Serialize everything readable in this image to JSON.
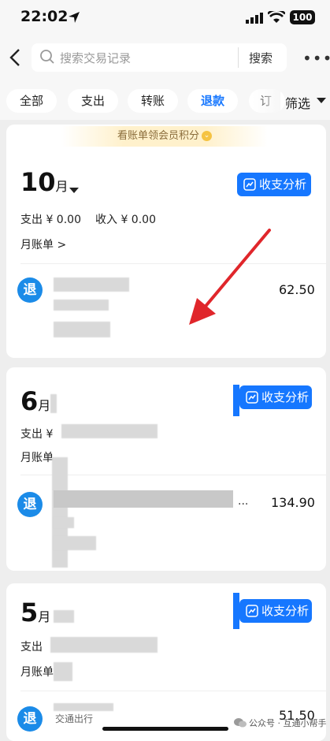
{
  "status_bar": {
    "time": "22:02",
    "battery": "100"
  },
  "search": {
    "placeholder": "搜索交易记录",
    "button_label": "搜索"
  },
  "filters": [
    {
      "label": "全部",
      "active": false
    },
    {
      "label": "支出",
      "active": false
    },
    {
      "label": "转账",
      "active": false
    },
    {
      "label": "退款",
      "active": true
    },
    {
      "label": "订",
      "active": false
    }
  ],
  "filter_menu_label": "筛选",
  "banner_text": "看账单领会员积分",
  "months": [
    {
      "month": "10",
      "unit": "月",
      "expense": "支出 ¥ 0.00",
      "income": "收入 ¥ 0.00",
      "bill_label": "月账单",
      "analyze_label": "收支分析",
      "entry": {
        "badge": "退",
        "amount": "62.50"
      }
    },
    {
      "month": "6",
      "unit": "月",
      "expense": "支出 ¥",
      "bill_label": "月账单",
      "analyze_label": "收支分析",
      "entry": {
        "badge": "退",
        "amount": "134.90",
        "ellipsis": "..."
      }
    },
    {
      "month": "5",
      "unit": "月",
      "expense": "支出",
      "bill_label": "月账单",
      "analyze_label": "收支分析",
      "entry": {
        "badge": "退",
        "amount": "51.50",
        "caption": "交通出行"
      }
    }
  ],
  "watermark": "公众号 · 互通小帮手",
  "colors": {
    "accent": "#1677ff",
    "badge": "#1b8be8",
    "annotation_arrow": "#e0262b"
  }
}
